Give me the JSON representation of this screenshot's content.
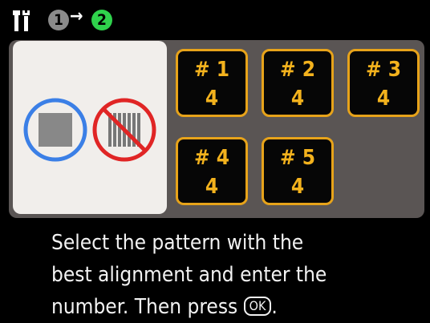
{
  "header": {
    "tool_icon": "wrench-screwdriver-icon",
    "step_current": "1",
    "step_arrow": "→",
    "step_next": "2"
  },
  "example": {
    "good_icon": "correct-pattern-icon",
    "bad_icon": "incorrect-pattern-icon",
    "colors": {
      "good": "#3b7fe6",
      "bad": "#e02525"
    }
  },
  "tiles": [
    {
      "label": "# 1",
      "value": "4"
    },
    {
      "label": "# 2",
      "value": "4"
    },
    {
      "label": "# 3",
      "value": "4"
    },
    {
      "label": "# 4",
      "value": "4"
    },
    {
      "label": "# 5",
      "value": "4"
    }
  ],
  "instruction": {
    "line1": "Select the pattern with the",
    "line2": "best alignment and enter the",
    "line3": "number. Then press ",
    "ok_label": "OK",
    "end": "."
  },
  "colors": {
    "accent": "#e7a31a",
    "panel": "#5a5554",
    "step_next": "#2fd24c"
  }
}
